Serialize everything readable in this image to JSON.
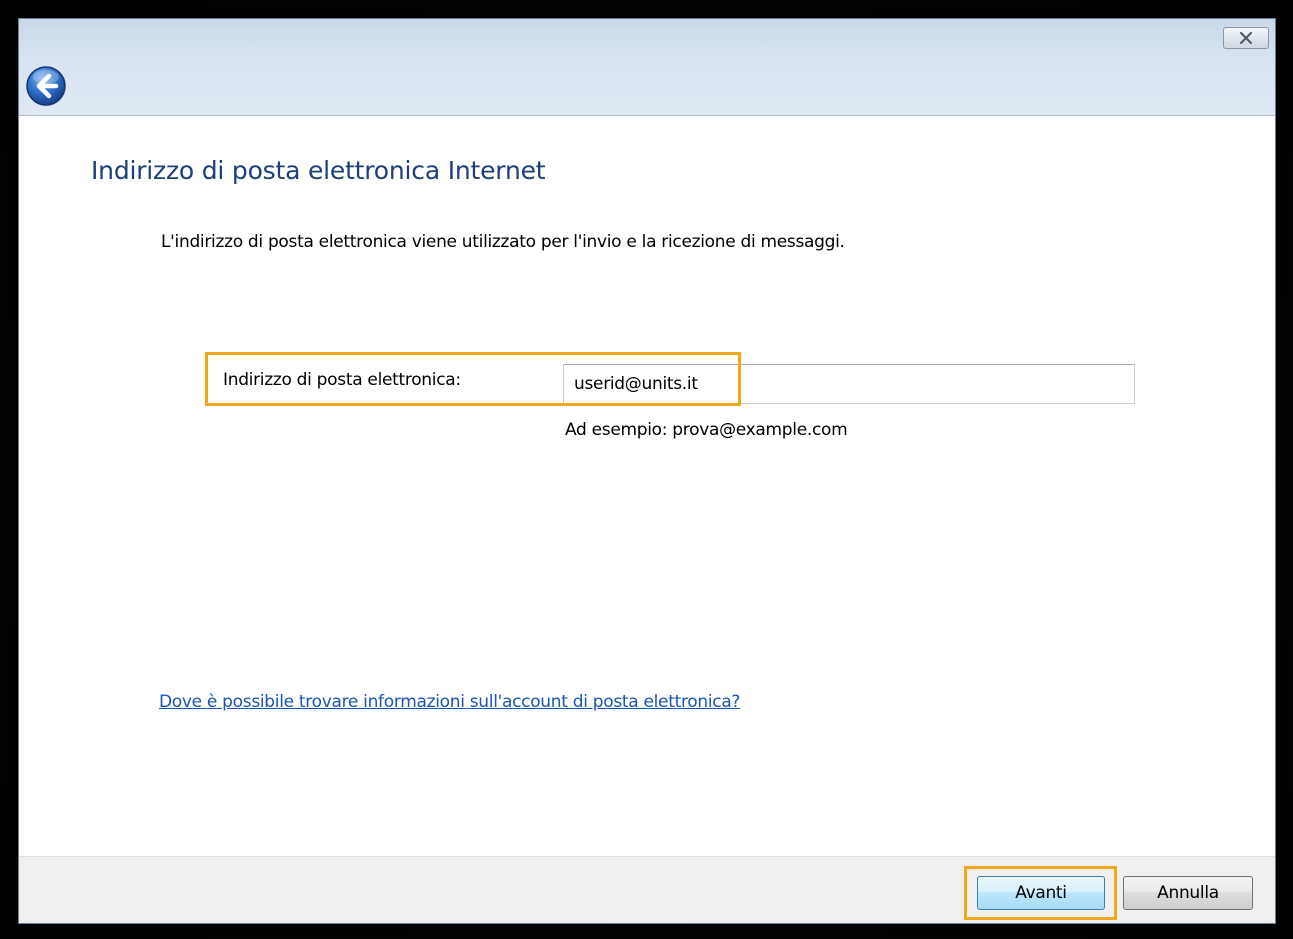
{
  "dialog": {
    "heading": "Indirizzo di posta elettronica Internet",
    "description": "L'indirizzo di posta elettronica viene utilizzato per l'invio e la ricezione di messaggi.",
    "email_label": "Indirizzo di posta elettronica:",
    "email_value": "userid@units.it",
    "example_hint": "Ad esempio: prova@example.com",
    "help_link": "Dove è possibile trovare informazioni sull'account di posta elettronica?"
  },
  "titlebar": {
    "back_icon": "back-arrow-icon",
    "close_icon": "close-icon"
  },
  "footer": {
    "next_label": "Avanti",
    "cancel_label": "Annulla"
  },
  "colors": {
    "heading": "#1f3f7a",
    "link": "#1a55b3",
    "highlight": "#f2a81d",
    "titlebar": "#d8e4f1"
  }
}
